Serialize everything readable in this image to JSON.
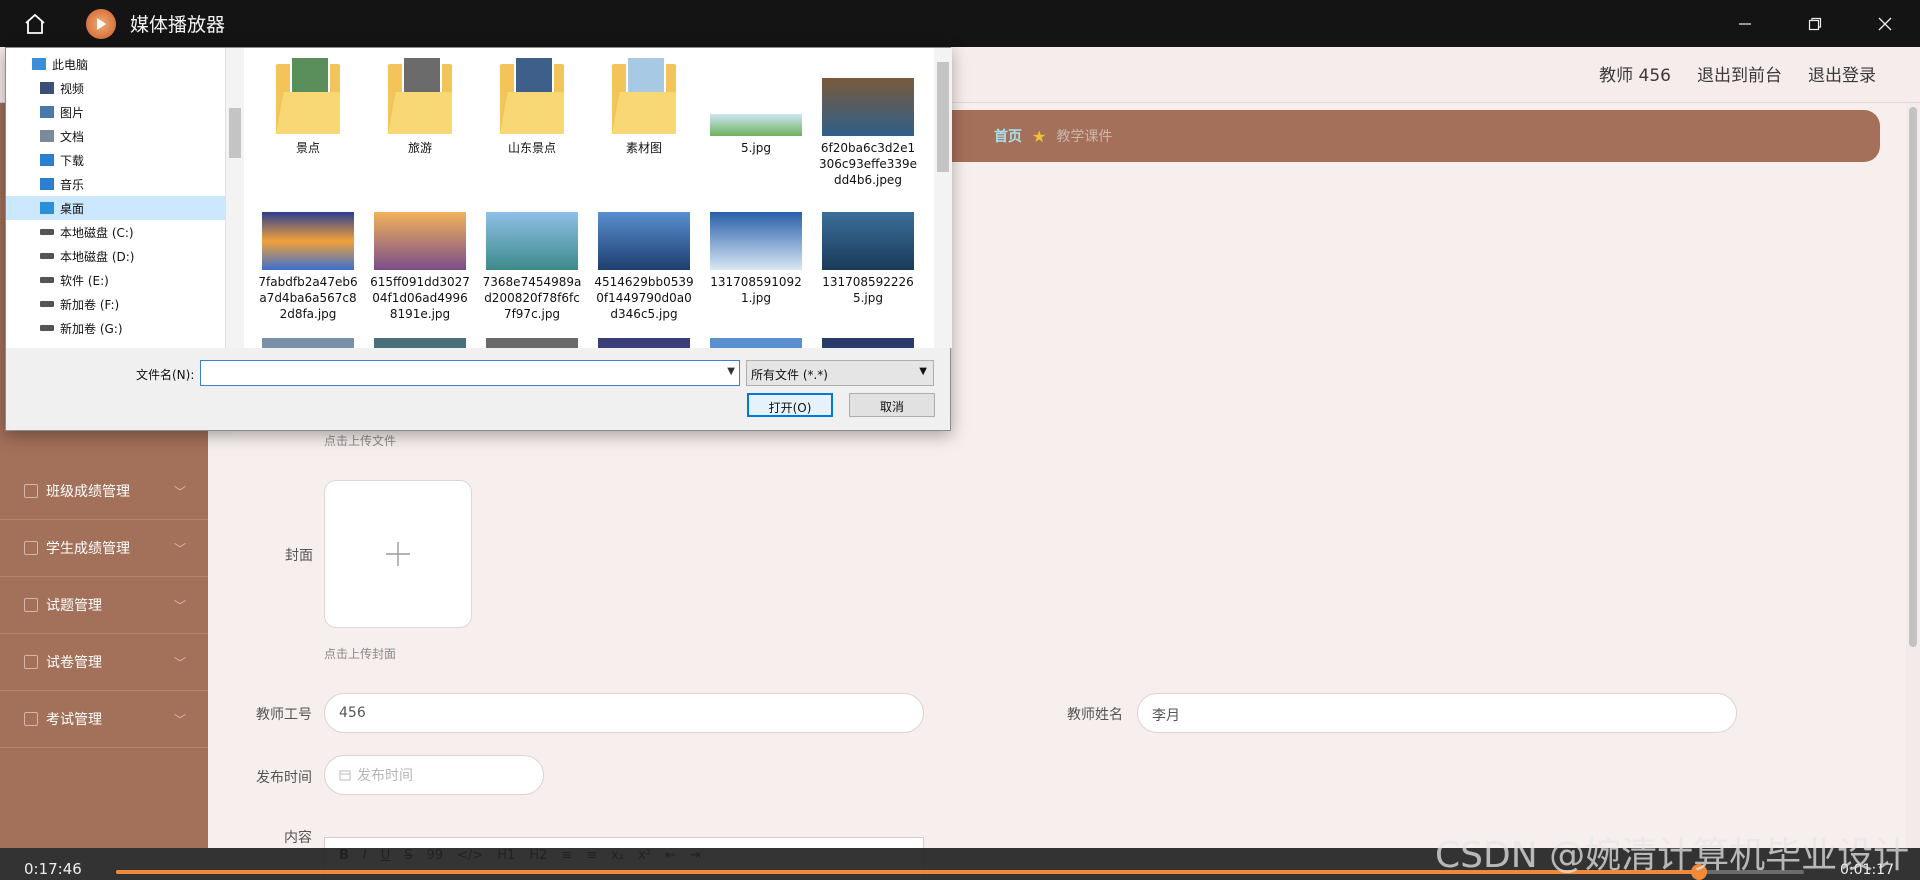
{
  "player": {
    "app_title": "媒体播放器",
    "time_elapsed": "0:17:46",
    "time_remaining": "0:01:17",
    "progress_fraction": 0.938
  },
  "header": {
    "links": [
      "教师 456",
      "退出到前台",
      "退出登录"
    ]
  },
  "breadcrumb": {
    "home": "首页",
    "current": "教学课件"
  },
  "sidebar": {
    "items": [
      {
        "label": "班级成绩管理",
        "icon": "copy-icon"
      },
      {
        "label": "学生成绩管理",
        "icon": "mic-icon"
      },
      {
        "label": "试题管理",
        "icon": "briefcase-icon"
      },
      {
        "label": "试卷管理",
        "icon": "printer-icon"
      },
      {
        "label": "考试管理",
        "icon": "mic-icon"
      }
    ]
  },
  "form": {
    "upload_file_hint": "点击上传文件",
    "cover_label": "封面",
    "upload_cover_hint": "点击上传封面",
    "teacher_id_label": "教师工号",
    "teacher_id_value": "456",
    "teacher_name_label": "教师姓名",
    "teacher_name_value": "李月",
    "publish_time_label": "发布时间",
    "publish_time_placeholder": "发布时间",
    "content_label": "内容",
    "editor_tools": [
      "B",
      "I",
      "U",
      "S",
      "99",
      "</>",
      "H1",
      "H2",
      "≡",
      "≡",
      "x₂",
      "x²",
      "⇤",
      "⇥"
    ]
  },
  "dialog": {
    "tree": [
      {
        "label": "此电脑",
        "icon": "computer-icon",
        "indent": 0
      },
      {
        "label": "视频",
        "icon": "video-folder-icon",
        "indent": 1
      },
      {
        "label": "图片",
        "icon": "picture-folder-icon",
        "indent": 1
      },
      {
        "label": "文档",
        "icon": "document-folder-icon",
        "indent": 1
      },
      {
        "label": "下载",
        "icon": "download-icon",
        "indent": 1
      },
      {
        "label": "音乐",
        "icon": "music-icon",
        "indent": 1
      },
      {
        "label": "桌面",
        "icon": "desktop-icon",
        "indent": 1,
        "selected": true
      },
      {
        "label": "本地磁盘 (C:)",
        "icon": "drive-icon",
        "indent": 1
      },
      {
        "label": "本地磁盘 (D:)",
        "icon": "drive-icon",
        "indent": 1
      },
      {
        "label": "软件 (E:)",
        "icon": "drive-icon",
        "indent": 1
      },
      {
        "label": "新加卷 (F:)",
        "icon": "drive-icon",
        "indent": 1
      },
      {
        "label": "新加卷 (G:)",
        "icon": "drive-icon",
        "indent": 1
      }
    ],
    "files_row1": [
      {
        "name": "景点",
        "type": "folder",
        "photo": "#5a8e5a"
      },
      {
        "name": "旅游",
        "type": "folder",
        "photo": "#6b6b6b"
      },
      {
        "name": "山东景点",
        "type": "folder",
        "photo": "#3d5f8a"
      },
      {
        "name": "素材图",
        "type": "folder",
        "photo": "#a8c9e3"
      },
      {
        "name": "5.jpg",
        "type": "image",
        "grad": "linear-gradient(#cfe6f5,#6db15a)"
      },
      {
        "name": "6f20ba6c3d2e1306c93effe339edd4b6.jpeg",
        "type": "image",
        "grad": "linear-gradient(#7a5a3a,#2f5f8a)"
      }
    ],
    "files_row2": [
      {
        "name": "7fabdfb2a47eb6a7d4ba6a567c82d8fa.jpg",
        "type": "image",
        "grad": "linear-gradient(#2c3e8f,#f2a23a,#3a6fd0)"
      },
      {
        "name": "615ff091dd302704f1d06ad49968191e.jpg",
        "type": "image",
        "grad": "linear-gradient(#f2b25a,#7a4d8a)"
      },
      {
        "name": "7368e7454989ad200820f78f6fc7f97c.jpg",
        "type": "image",
        "grad": "linear-gradient(#8fc0e8,#3d8a8a)"
      },
      {
        "name": "4514629bb05390f1449790d0a0d346c5.jpg",
        "type": "image",
        "grad": "linear-gradient(#5a8fd0,#1d3f6f)"
      },
      {
        "name": "1317085910921.jpg",
        "type": "image",
        "grad": "linear-gradient(#2a5fa8,#d8e8f5)"
      },
      {
        "name": "1317085922265.jpg",
        "type": "image",
        "grad": "linear-gradient(#3a6f9a,#1a3a5a)"
      }
    ],
    "filename_label": "文件名(N):",
    "filename_value": "",
    "filetype_value": "所有文件 (*.*)",
    "open_label": "打开(O)",
    "cancel_label": "取消"
  },
  "watermark": "CSDN @婉清计算机毕业设计"
}
